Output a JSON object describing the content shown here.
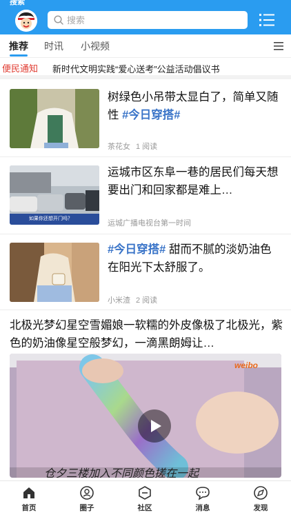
{
  "status_bar": {
    "title": "搜索"
  },
  "header": {
    "avatar": "cartoon-avatar",
    "search": {
      "placeholder": "搜索"
    },
    "menu_icon": "list-menu-icon"
  },
  "tabs": {
    "items": [
      {
        "label": "推荐",
        "active": true
      },
      {
        "label": "时讯",
        "active": false
      },
      {
        "label": "小视频",
        "active": false
      }
    ],
    "more_icon": "hamburger-icon"
  },
  "notice": {
    "badge": "便民通知",
    "text": "新时代文明实践“爱心送考”公益活动倡议书"
  },
  "feed": {
    "items": [
      {
        "title_text": "树绿色小吊带太显白了，简单又随性",
        "hashtag": "#今日穿搭#",
        "author": "茶花女",
        "reads": "1 阅读"
      },
      {
        "title_text": "运城市区东阜一巷的居民们每天想要出门和回家都是难上…",
        "author": "运城广播电视台第一时间",
        "thumb_caption": "如果你还想开门吗？"
      },
      {
        "hashtag": "#今日穿搭#",
        "title_text": "甜而不腻的淡奶油色在阳光下太舒服了。",
        "author": "小米渣",
        "reads": "2 阅读"
      }
    ],
    "video_post": {
      "title": "北极光梦幻星空雪媚娘一软糯的外皮像极了北极光，紫色的奶油像星空般梦幻，一滴黑朗姆让…",
      "watermark": "weibo",
      "subtitle": "仓夕三楼加入不同颜色搓在一起"
    }
  },
  "bottom_nav": {
    "items": [
      {
        "label": "首页",
        "icon": "home-icon",
        "active": true
      },
      {
        "label": "圈子",
        "icon": "circle-icon",
        "active": false
      },
      {
        "label": "社区",
        "icon": "community-icon",
        "active": false
      },
      {
        "label": "消息",
        "icon": "message-icon",
        "active": false
      },
      {
        "label": "发现",
        "icon": "discover-icon",
        "active": false
      }
    ]
  },
  "colors": {
    "brand": "#2a9cf0",
    "notice_red": "#e03a2f",
    "hashtag_blue": "#3a74c8"
  }
}
